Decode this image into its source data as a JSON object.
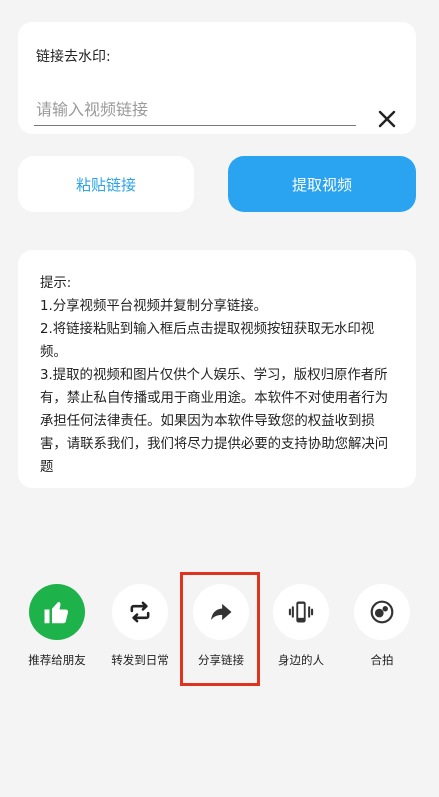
{
  "link_card": {
    "label": "链接去水印:",
    "input_placeholder": "请输入视频链接",
    "input_value": "",
    "clear_icon": "close-icon"
  },
  "buttons": {
    "paste_label": "粘贴链接",
    "extract_label": "提取视频"
  },
  "tips": {
    "title": "提示:",
    "lines": [
      "1.分享视频平台视频并复制分享链接。",
      "2.将链接粘贴到输入框后点击提取视频按钮获取无水印视频。",
      "3.提取的视频和图片仅供个人娱乐、学习，版权归原作者所有，禁止私自传播或用于商业用途。本软件不对使用者行为承担任何法律责任。如果因为本软件导致您的权益收到损害，请联系我们，我们将尽力提供必要的支持协助您解决问题"
    ]
  },
  "share_row": {
    "items": [
      {
        "label": "推荐给朋友",
        "icon": "thumbs-up-icon"
      },
      {
        "label": "转发到日常",
        "icon": "repost-icon"
      },
      {
        "label": "分享链接",
        "icon": "share-arrow-icon"
      },
      {
        "label": "身边的人",
        "icon": "phone-vibrate-icon"
      },
      {
        "label": "合拍",
        "icon": "duet-icon"
      }
    ]
  },
  "colors": {
    "accent": "#2aa3f0",
    "green": "#1db24a",
    "highlight": "#e0331f",
    "background": "#f4f4f4"
  }
}
